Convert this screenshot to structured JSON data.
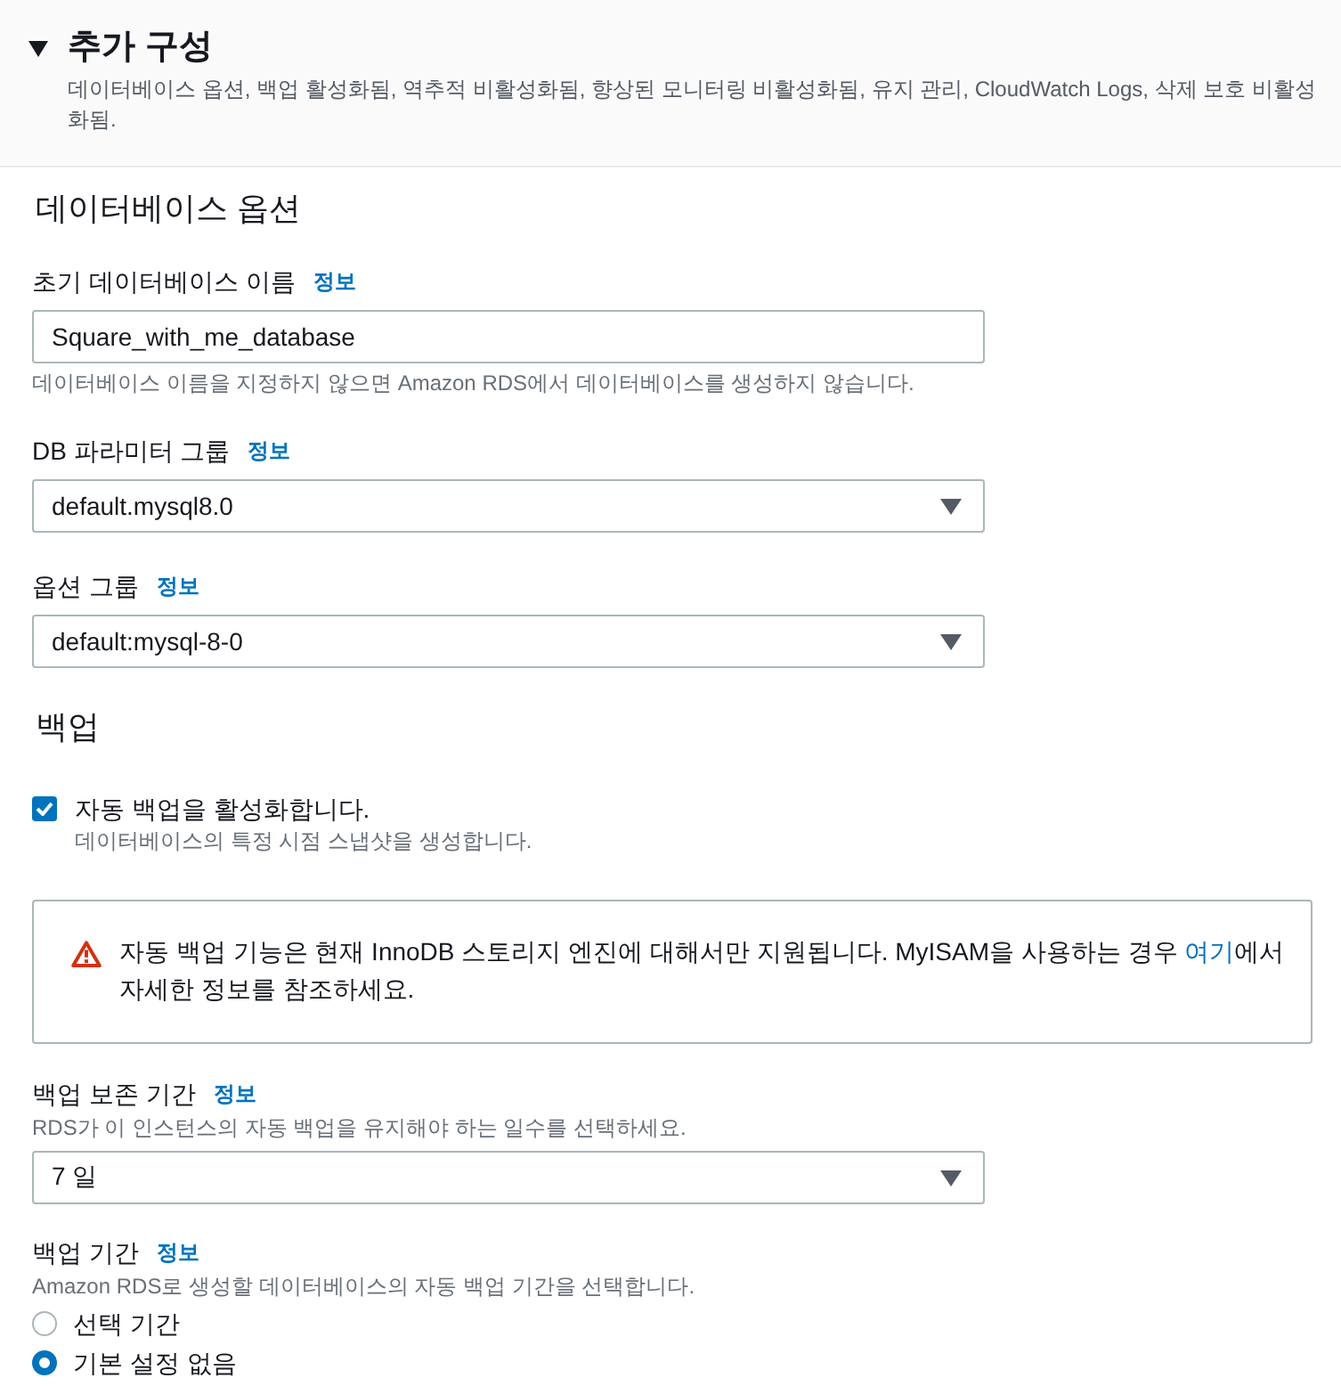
{
  "section": {
    "title": "추가 구성",
    "expanded": true,
    "description": "데이터베이스 옵션, 백업 활성화됨, 역추적 비활성화됨, 향상된 모니터링 비활성화됨, 유지 관리, CloudWatch Logs, 삭제 보호 비활성화됨."
  },
  "database_options": {
    "heading": "데이터베이스 옵션",
    "fields": [
      {
        "kind": "text",
        "label": "초기 데이터베이스 이름",
        "info": "정보",
        "value": "Square_with_me_database",
        "hint": "데이터베이스 이름을 지정하지 않으면 Amazon RDS에서 데이터베이스를 생성하지 않습니다."
      },
      {
        "kind": "select",
        "label": "DB 파라미터 그룹",
        "info": "정보",
        "value": "default.mysql8.0"
      },
      {
        "kind": "select",
        "label": "옵션 그룹",
        "info": "정보",
        "value": "default:mysql-8-0"
      }
    ]
  },
  "backup": {
    "heading": "백업",
    "auto_backup": {
      "label": "자동 백업을 활성화합니다.",
      "description": "데이터베이스의 특정 시점 스냅샷을 생성합니다.",
      "checked": true
    },
    "alert": {
      "kind": "warning",
      "text_before": "자동 백업 기능은 현재 InnoDB 스토리지 엔진에 대해서만 지원됩니다. MyISAM을 사용하는 경우 ",
      "link": "여기",
      "text_after": "에서 자세한 정보를 참조하세요."
    },
    "fields": [
      {
        "kind": "select",
        "label": "백업 보존 기간",
        "info": "정보",
        "description": "RDS가 이 인스턴스의 자동 백업을 유지해야 하는 일수를 선택하세요.",
        "value": "7 일"
      },
      {
        "kind": "radio",
        "label": "백업 기간",
        "info": "정보",
        "description": "Amazon RDS로 생성할 데이터베이스의 자동 백업 기간을 선택합니다.",
        "options": [
          {
            "label": "선택 기간",
            "selected": false
          },
          {
            "label": "기본 설정 없음",
            "selected": true
          }
        ]
      }
    ]
  }
}
